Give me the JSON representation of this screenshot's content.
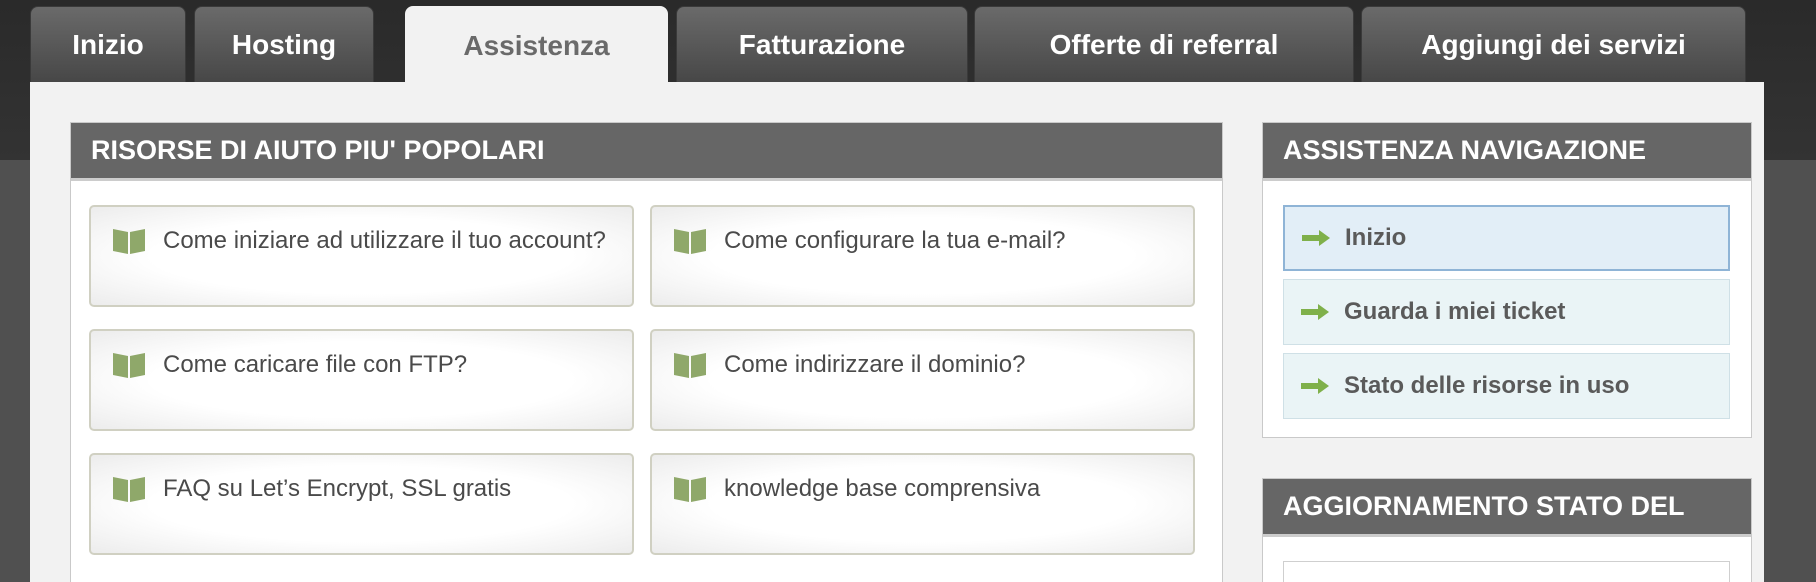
{
  "tabs": [
    {
      "label": "Inizio"
    },
    {
      "label": "Hosting"
    },
    {
      "label": "Assistenza"
    },
    {
      "label": "Fatturazione"
    },
    {
      "label": "Offerte di referral"
    },
    {
      "label": "Aggiungi dei servizi"
    }
  ],
  "popular": {
    "title": "RISORSE DI AIUTO PIU' POPOLARI",
    "items": [
      {
        "label": "Come iniziare ad utilizzare il tuo account?"
      },
      {
        "label": "Come configurare la tua e-mail?"
      },
      {
        "label": "Come caricare file con FTP?"
      },
      {
        "label": "Come indirizzare il dominio?"
      },
      {
        "label": "FAQ su Let’s Encrypt, SSL gratis"
      },
      {
        "label": "knowledge base comprensiva"
      }
    ]
  },
  "support_nav": {
    "title": "ASSISTENZA NAVIGAZIONE",
    "items": [
      {
        "label": "Inizio"
      },
      {
        "label": "Guarda i miei ticket"
      },
      {
        "label": "Stato delle risorse in uso"
      }
    ]
  },
  "status_update": {
    "title": "AGGIORNAMENTO STATO DEL"
  },
  "colors": {
    "header_bg": "#666666",
    "book_icon": "#8fa86a",
    "arrow_icon": "#7fb04a"
  }
}
